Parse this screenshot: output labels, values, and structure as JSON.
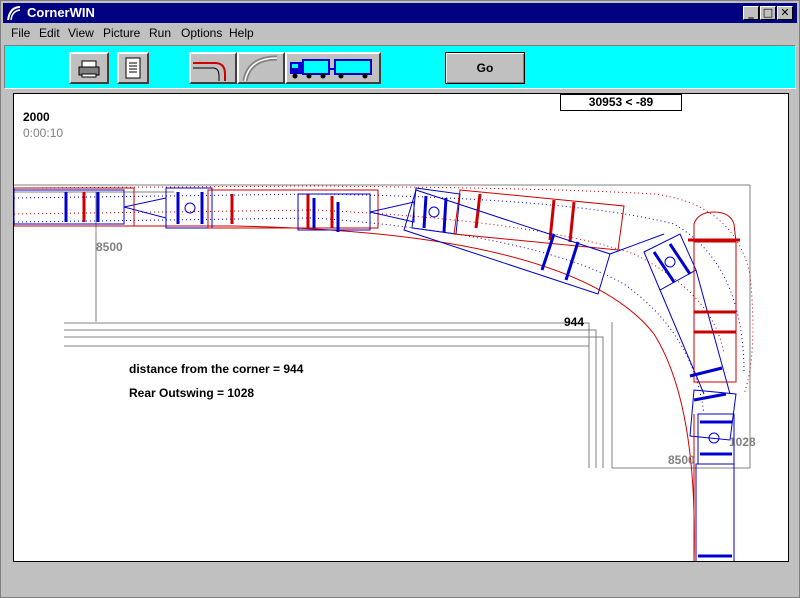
{
  "window": {
    "title": "CornerWIN"
  },
  "window_controls": {
    "minimize": "_",
    "maximize": "□",
    "close": "✕"
  },
  "menu": {
    "items": [
      "File",
      "Edit",
      "View",
      "Picture",
      "Run",
      "Options",
      "Help"
    ]
  },
  "toolbar": {
    "icons": [
      "printer-icon",
      "document-icon",
      "corner-path-icon",
      "curve-path-icon",
      "truck-trailer-icon"
    ],
    "go_label": "Go"
  },
  "canvas": {
    "readout": "30953 < -89",
    "year": "2000",
    "elapsed_time": "0:00:10",
    "distance_label": "distance from the corner =  944",
    "outswing_label": "Rear Outswing = 1028",
    "dim_top_8500": "8500",
    "dim_bottom_8500": "8500",
    "dim_944": "944",
    "dim_1028": "1028"
  },
  "colors": {
    "title_bar": "#000080",
    "toolbar_bg": "#00ffff",
    "path_red": "#cc0000",
    "path_blue": "#0000cc",
    "road_gray": "#808080"
  }
}
